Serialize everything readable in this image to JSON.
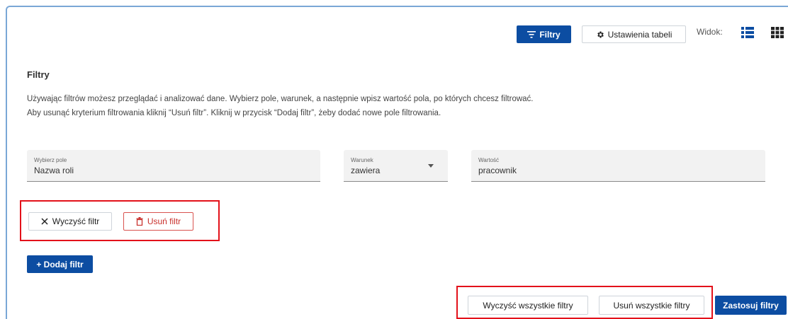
{
  "toolbar": {
    "filters_label": "Filtry",
    "table_settings_label": "Ustawienia tabeli",
    "view_label": "Widok:"
  },
  "filters": {
    "title": "Filtry",
    "description_line1": "Używając filtrów możesz przeglądać i analizować dane. Wybierz pole, warunek, a następnie wpisz wartość pola, po których chcesz filtrować.",
    "description_line2": "Aby usunąć kryterium filtrowania kliknij “Usuń filtr”. Kliknij w przycisk “Dodaj filtr”, żeby dodać nowe pole filtrowania.",
    "field": {
      "label": "Wybierz pole",
      "value": "Nazwa roli"
    },
    "condition": {
      "label": "Warunek",
      "value": "zawiera"
    },
    "value": {
      "label": "Wartość",
      "value": "pracownik"
    },
    "clear_filter_label": "Wyczyść filtr",
    "remove_filter_label": "Usuń filtr",
    "add_filter_label": "+ Dodaj filtr",
    "clear_all_label": "Wyczyść wszystkie filtry",
    "remove_all_label": "Usuń wszystkie filtry",
    "apply_label": "Zastosuj filtry"
  },
  "icons": {
    "filter": "filter-icon",
    "gear": "gear-icon",
    "list_view": "list-view-icon",
    "grid_view": "grid-view-icon",
    "close": "close-icon",
    "trash": "trash-icon"
  },
  "colors": {
    "primary": "#0c4da2",
    "danger": "#c9302c",
    "highlight": "#e3111a"
  }
}
